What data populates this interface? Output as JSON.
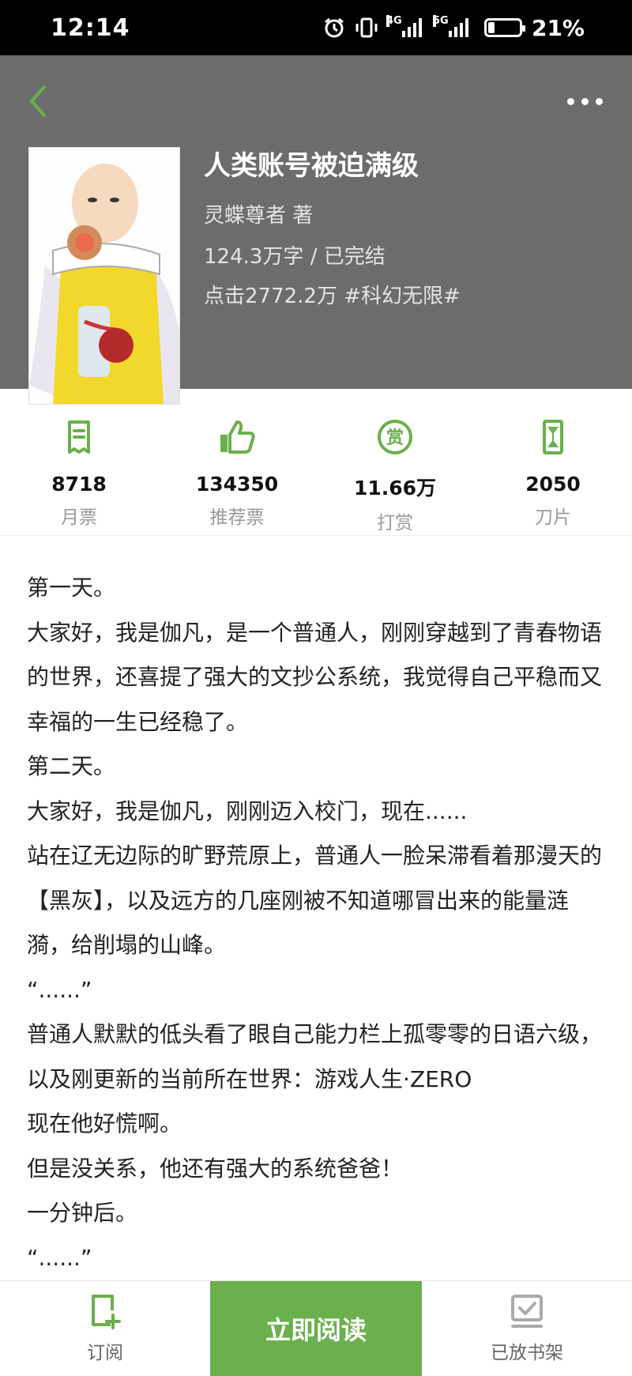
{
  "status_bar": {
    "time": "12:14",
    "net1": "4G",
    "net2": "5G",
    "battery_level": 0.21,
    "battery_text": "21%",
    "icons": [
      "alarm-icon",
      "vibrate-icon",
      "signal-4g-icon",
      "signal-5g-icon",
      "battery-icon"
    ]
  },
  "header": {
    "back_icon": "chevron-left-icon",
    "more_icon": "more-dots-icon",
    "cover_description": "cover-image",
    "title": "人类账号被迫满级",
    "author_line": "灵蝶尊者  著",
    "words_line": "124.3万字 / 已完结",
    "clicks_line": "点击2772.2万  #科幻无限#"
  },
  "stats": [
    {
      "icon": "monthly-ticket-icon",
      "value": "8718",
      "label": "月票"
    },
    {
      "icon": "thumbs-up-icon",
      "value": "134350",
      "label": "推荐票"
    },
    {
      "icon": "reward-icon",
      "value": "11.66万",
      "label": "打赏"
    },
    {
      "icon": "blade-icon",
      "value": "2050",
      "label": "刀片"
    }
  ],
  "content": {
    "lines": [
      "第一天。",
      "大家好，我是伽凡，是一个普通人，刚刚穿越到了青春物语的世界，还喜提了强大的文抄公系统，我觉得自己平稳而又幸福的一生已经稳了。",
      "第二天。",
      "大家好，我是伽凡，刚刚迈入校门，现在......",
      "站在辽无边际的旷野荒原上，普通人一脸呆滞看着那漫天的【黑灰】，以及远方的几座刚被不知道哪冒出来的能量涟漪，给削塌的山峰。",
      "“......”",
      "普通人默默的低头看了眼自己能力栏上孤零零的日语六级，以及刚更新的当前所在世界：游戏人生·ZERO",
      "现在他好慌啊。",
      "但是没关系，他还有强大的系统爸爸！",
      "一分钟后。",
      "“......”"
    ]
  },
  "bottom_bar": {
    "subscribe_label": "订阅",
    "read_label": "立即阅读",
    "shelf_label": "已放书架"
  },
  "colors": {
    "accent": "#6ab04c",
    "header_bg": "#6b6d6c",
    "status_bg": "#000000"
  }
}
